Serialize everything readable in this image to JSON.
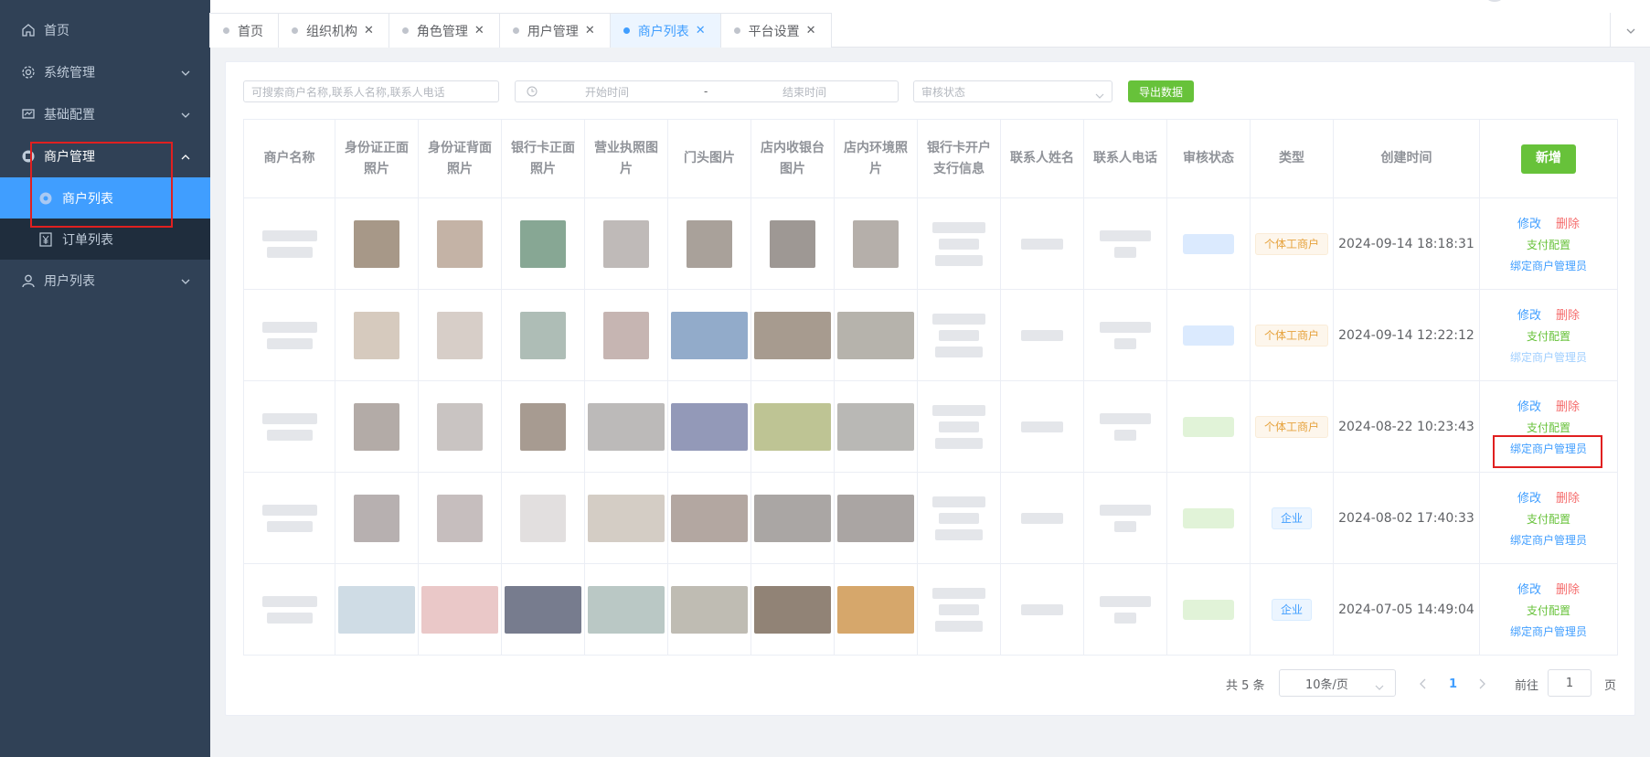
{
  "sidebar": {
    "items": [
      {
        "label": "首页",
        "icon": "home-icon"
      },
      {
        "label": "系统管理",
        "icon": "gear-icon"
      },
      {
        "label": "基础配置",
        "icon": "monitor-icon"
      },
      {
        "label": "商户管理",
        "icon": "merchant-icon",
        "open": true,
        "children": [
          {
            "label": "商户列表",
            "icon": "gear-icon",
            "active": true
          },
          {
            "label": "订单列表",
            "icon": "yen-icon"
          }
        ]
      },
      {
        "label": "用户列表",
        "icon": "user-icon"
      }
    ]
  },
  "tabs": [
    {
      "label": "首页",
      "closable": false
    },
    {
      "label": "组织机构",
      "closable": true
    },
    {
      "label": "角色管理",
      "closable": true
    },
    {
      "label": "用户管理",
      "closable": true
    },
    {
      "label": "商户列表",
      "closable": true,
      "active": true
    },
    {
      "label": "平台设置",
      "closable": true
    }
  ],
  "filters": {
    "search_placeholder": "可搜索商户名称,联系人名称,联系人电话",
    "start_placeholder": "开始时间",
    "range_separator": "-",
    "end_placeholder": "结束时间",
    "status_placeholder": "审核状态",
    "export_label": "导出数据"
  },
  "table": {
    "headers": [
      "商户名称",
      "身份证正面照片",
      "身份证背面照片",
      "银行卡正面照片",
      "营业执照图片",
      "门头图片",
      "店内收银台图片",
      "店内环境照片",
      "银行卡开户支行信息",
      "联系人姓名",
      "联系人电话",
      "审核状态",
      "类型",
      "创建时间"
    ],
    "add_label": "新增",
    "rows": [
      {
        "type": "个体工商户",
        "created": "2024-09-14 18:18:31"
      },
      {
        "type": "个体工商户",
        "created": "2024-09-14 12:22:12"
      },
      {
        "type": "个体工商户",
        "created": "2024-08-22 10:23:43"
      },
      {
        "type": "企业",
        "created": "2024-08-02 17:40:33"
      },
      {
        "type": "企业",
        "created": "2024-07-05 14:49:04"
      }
    ],
    "ops": {
      "edit": "修改",
      "delete": "删除",
      "pay_config": "支付配置",
      "bind_admin": "绑定商户管理员"
    }
  },
  "pagination": {
    "total_text": "共 5 条",
    "page_size": "10条/页",
    "current_page": "1",
    "goto_label": "前往",
    "goto_value": "1",
    "page_unit": "页"
  },
  "colors": {
    "sidebar_bg": "#304156",
    "accent": "#409eff",
    "success": "#67c23a",
    "danger": "#f56c6c",
    "highlight_box": "#e02020"
  }
}
